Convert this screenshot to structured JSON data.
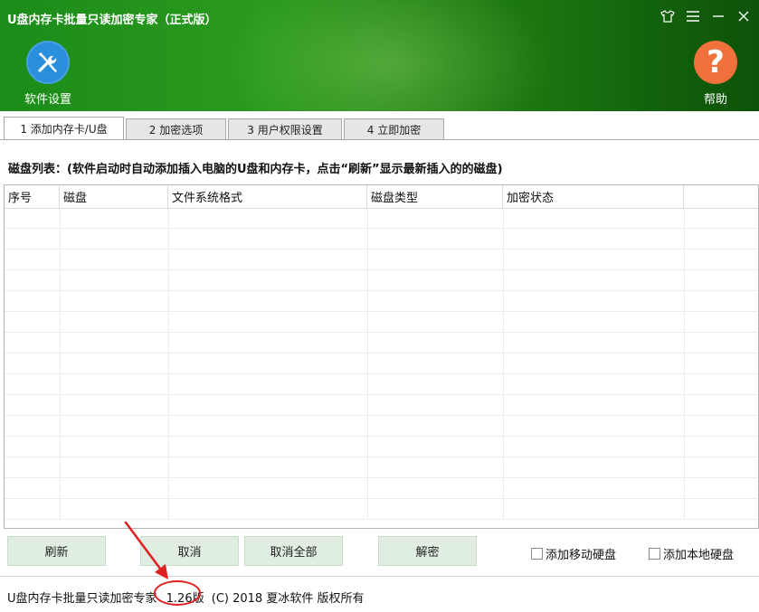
{
  "window": {
    "title": "U盘内存卡批量只读加密专家（正式版）"
  },
  "toolbar": {
    "settings_label": "软件设置",
    "help_label": "帮助",
    "help_glyph": "?"
  },
  "tabs": [
    {
      "label": "1 添加内存卡/U盘",
      "active": true
    },
    {
      "label": "2 加密选项",
      "active": false
    },
    {
      "label": "3 用户权限设置",
      "active": false
    },
    {
      "label": "4 立即加密",
      "active": false
    }
  ],
  "section": {
    "title": "磁盘列表：(软件启动时自动添加插入电脑的U盘和内存卡，点击“刷新”显示最新插入的的磁盘)"
  },
  "table": {
    "headers": [
      "序号",
      "磁盘",
      "文件系统格式",
      "磁盘类型",
      "加密状态",
      ""
    ],
    "rows": []
  },
  "actions": {
    "refresh": "刷新",
    "cancel": "取消",
    "cancel_all": "取消全部",
    "decrypt": "解密"
  },
  "options": {
    "add_removable": {
      "label": "添加移动硬盘",
      "checked": false
    },
    "add_local": {
      "label": "添加本地硬盘",
      "checked": false
    }
  },
  "footer": {
    "product": "U盘内存卡批量只读加密专家",
    "version": "1.26版",
    "copyright": "(C) 2018 夏冰软件 版权所有"
  },
  "colors": {
    "header_green": "#1f8a18",
    "settings_blue": "#2a8fdc",
    "help_orange": "#f0713c",
    "button_bg": "#dfeee0",
    "annotation_red": "#e02020"
  }
}
